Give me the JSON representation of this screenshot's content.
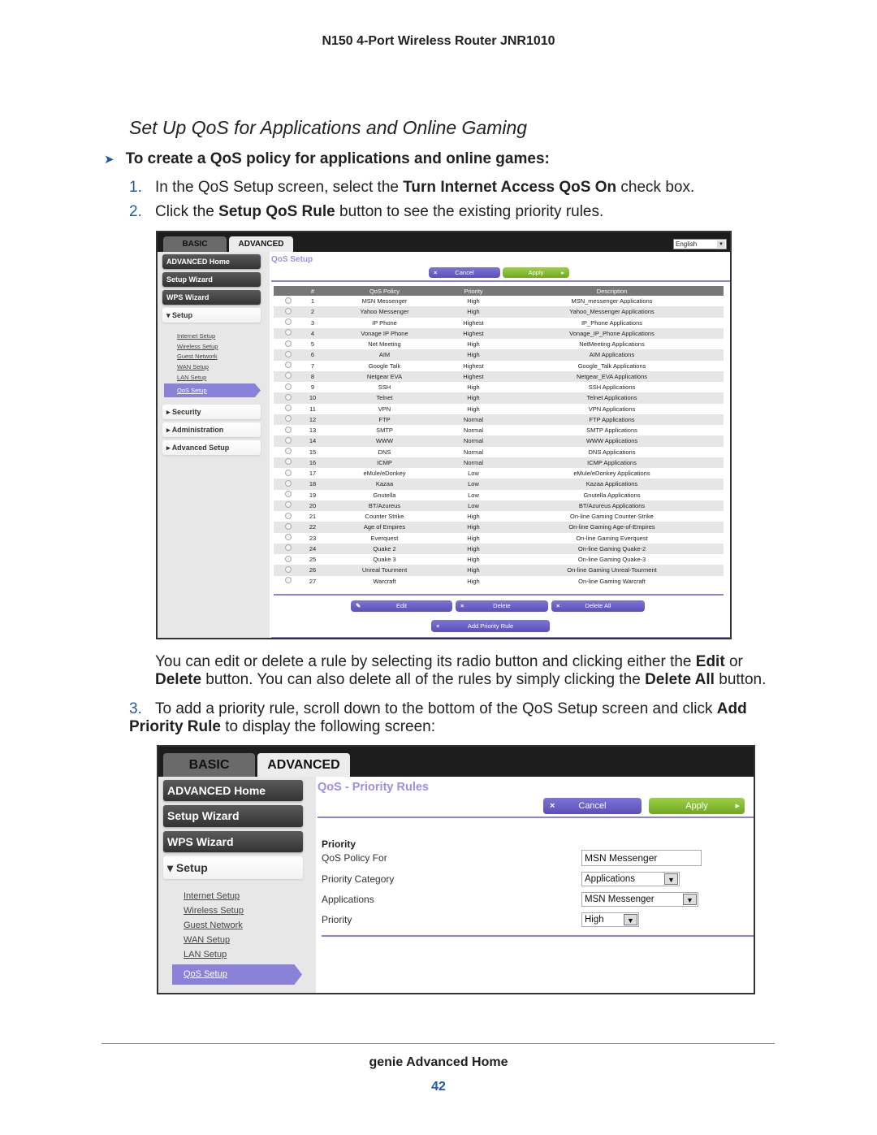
{
  "header": "N150 4-Port Wireless Router JNR1010",
  "section_title": "Set Up QoS for Applications and Online Gaming",
  "procedure": "To create a QoS policy for applications and online games:",
  "steps": [
    {
      "n": "1.",
      "pre": "In the QoS Setup screen, select the ",
      "bold": "Turn Internet Access QoS On",
      "post": " check box."
    },
    {
      "n": "2.",
      "pre": "Click the ",
      "bold": "Setup QoS Rule",
      "post": " button to see the existing priority rules."
    },
    {
      "n": "3.",
      "pre": "To add a priority rule, scroll down to the bottom of the QoS Setup screen and click ",
      "bold": "Add Priority Rule",
      "post": " to display the following screen:"
    }
  ],
  "para": {
    "a": "You can edit or delete a rule by selecting its radio button and clicking either the ",
    "b": "Edit",
    "c": " or ",
    "d": "Delete",
    "e": " button. You can also delete all of the rules by simply clicking the ",
    "f": "Delete All",
    "g": " button."
  },
  "router": {
    "tabs": [
      "BASIC",
      "ADVANCED"
    ],
    "language": "English",
    "sidebar": {
      "buttons": [
        "ADVANCED Home",
        "Setup Wizard",
        "WPS Wizard"
      ],
      "setup": "Setup",
      "links": [
        "Internet Setup",
        "Wireless Setup",
        "Guest Network",
        "WAN Setup",
        "LAN Setup"
      ],
      "selected": "QoS Setup",
      "sections": [
        "Security",
        "Administration",
        "Advanced Setup"
      ]
    },
    "cancel": "Cancel",
    "apply": "Apply"
  },
  "qos_setup": {
    "title": "QoS Setup",
    "columns": [
      "#",
      "QoS Policy",
      "Priority",
      "Description"
    ],
    "rows": [
      [
        "1",
        "MSN Messenger",
        "High",
        "MSN_messenger Applications"
      ],
      [
        "2",
        "Yahoo Messenger",
        "High",
        "Yahoo_Messenger Applications"
      ],
      [
        "3",
        "IP Phone",
        "Highest",
        "IP_Phone Applications"
      ],
      [
        "4",
        "Vonage IP Phone",
        "Highest",
        "Vonage_IP_Phone Applications"
      ],
      [
        "5",
        "Net Meeting",
        "High",
        "NetMeeting Applications"
      ],
      [
        "6",
        "AIM",
        "High",
        "AIM Applications"
      ],
      [
        "7",
        "Google Talk",
        "Highest",
        "Google_Talk Applications"
      ],
      [
        "8",
        "Netgear EVA",
        "Highest",
        "Netgear_EVA Applications"
      ],
      [
        "9",
        "SSH",
        "High",
        "SSH Applications"
      ],
      [
        "10",
        "Telnet",
        "High",
        "Telnet Applications"
      ],
      [
        "11",
        "VPN",
        "High",
        "VPN Applications"
      ],
      [
        "12",
        "FTP",
        "Normal",
        "FTP Applications"
      ],
      [
        "13",
        "SMTP",
        "Normal",
        "SMTP Applications"
      ],
      [
        "14",
        "WWW",
        "Normal",
        "WWW Applications"
      ],
      [
        "15",
        "DNS",
        "Normal",
        "DNS Applications"
      ],
      [
        "16",
        "ICMP",
        "Normal",
        "ICMP Applications"
      ],
      [
        "17",
        "eMule/eDonkey",
        "Low",
        "eMule/eDonkey Applications"
      ],
      [
        "18",
        "Kazaa",
        "Low",
        "Kazaa Applications"
      ],
      [
        "19",
        "Gnutella",
        "Low",
        "Gnutella Applications"
      ],
      [
        "20",
        "BT/Azureus",
        "Low",
        "BT/Azureus Applications"
      ],
      [
        "21",
        "Counter Strike",
        "High",
        "On-line Gaming Counter-Strike"
      ],
      [
        "22",
        "Age of Empires",
        "High",
        "On-line Gaming Age-of-Empires"
      ],
      [
        "23",
        "Everquest",
        "High",
        "On-line Gaming Everquest"
      ],
      [
        "24",
        "Quake 2",
        "High",
        "On-line Gaming Quake-2"
      ],
      [
        "25",
        "Quake 3",
        "High",
        "On-line Gaming Quake-3"
      ],
      [
        "26",
        "Unreal Tourment",
        "High",
        "On-line Gaming Unreal-Tourment"
      ],
      [
        "27",
        "Warcraft",
        "High",
        "On-line Gaming Warcraft"
      ]
    ],
    "edit": "Edit",
    "delete": "Delete",
    "delete_all": "Delete All",
    "add_rule": "Add Priority Rule"
  },
  "priority_rules": {
    "title": "QoS - Priority Rules",
    "section": "Priority",
    "labels": [
      "QoS Policy For",
      "Priority Category",
      "Applications",
      "Priority"
    ],
    "values": [
      "MSN Messenger",
      "Applications",
      "MSN Messenger",
      "High"
    ]
  },
  "footer": {
    "title": "genie Advanced Home",
    "page": "42"
  }
}
